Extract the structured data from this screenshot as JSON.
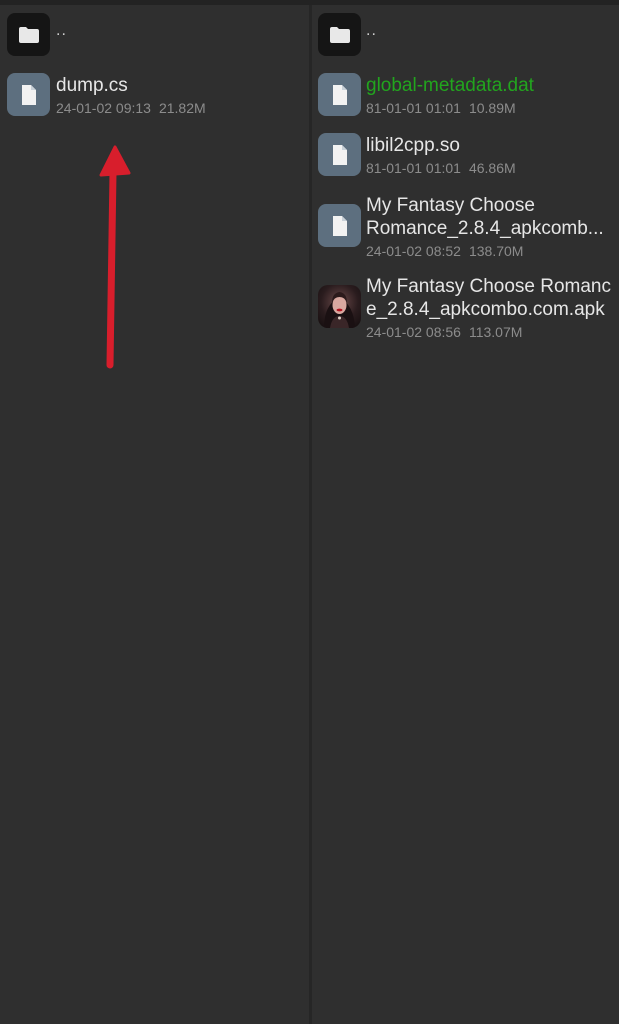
{
  "left_pane": {
    "parent": {
      "label": "..",
      "icon": "folder-icon"
    },
    "files": [
      {
        "name": "dump.cs",
        "date": "24-01-02 09:13",
        "size": "21.82M",
        "icon": "file-icon"
      }
    ]
  },
  "right_pane": {
    "parent": {
      "label": "..",
      "icon": "folder-icon"
    },
    "files": [
      {
        "name": "global-metadata.dat",
        "date": "81-01-01 01:01",
        "size": "10.89M",
        "icon": "file-icon",
        "highlight_color": "#22a51e"
      },
      {
        "name": "libil2cpp.so",
        "date": "81-01-01 01:01",
        "size": "46.86M",
        "icon": "file-icon"
      },
      {
        "name_line1": "My Fantasy Choose",
        "name_line2": "Romance_2.8.4_apkcomb...",
        "date": "24-01-02 08:52",
        "size": "138.70M",
        "icon": "file-icon"
      },
      {
        "name_line1": "My Fantasy Choose Romanc",
        "name_line2": "e_2.8.4_apkcombo.com.apk",
        "date": "24-01-02 08:56",
        "size": "113.07M",
        "icon": "apk-app-icon"
      }
    ]
  },
  "annotation": {
    "arrow_color": "#d81e2c",
    "arrow_icon": "red-arrow-up-icon"
  }
}
